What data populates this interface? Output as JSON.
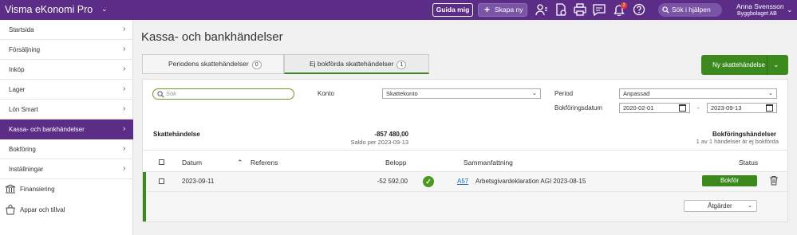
{
  "topbar": {
    "app_title": "Visma eKonomi Pro",
    "guide_label": "Guida mig",
    "create_label": "Skapa ny",
    "notification_count": "2",
    "help_search_label": "Sök i hjälpen",
    "user_name": "Anna Svensson",
    "company": "Byggbolaget AB",
    "icons": [
      "user-switch-icon",
      "document-icon",
      "print-icon",
      "chat-icon",
      "bell-icon",
      "help-icon",
      "search-icon"
    ]
  },
  "sidebar": {
    "items": [
      {
        "label": "Startsida"
      },
      {
        "label": "Försäljning"
      },
      {
        "label": "Inköp"
      },
      {
        "label": "Lager"
      },
      {
        "label": "Lön Smart"
      },
      {
        "label": "Kassa- och bankhändelser",
        "active": true
      },
      {
        "label": "Bokföring"
      },
      {
        "label": "Inställningar"
      }
    ],
    "extras": [
      {
        "label": "Finansiering",
        "icon": "finance-icon"
      },
      {
        "label": "Appar och tillval",
        "icon": "shopping-bag-icon"
      }
    ]
  },
  "page": {
    "title": "Kassa- och bankhändelser",
    "tabs": [
      {
        "label": "Periodens skattehändelser",
        "count": "0"
      },
      {
        "label": "Ej bokförda skattehändelser",
        "count": "1"
      }
    ],
    "new_button": "Ny skattehändelse"
  },
  "filters": {
    "search_placeholder": "Sök",
    "account_label": "Konto",
    "account_value": "Skattekonto",
    "period_label": "Period",
    "period_value": "Anpassad",
    "date_label": "Bokföringsdatum",
    "date_from": "2020-02-01",
    "date_sep": "-",
    "date_to": "2023-09-13"
  },
  "totals": {
    "label": "Skattehändelse",
    "amount": "-857 480,00",
    "saldo": "Saldo per 2023-09-13",
    "bf_title": "Bokföringshändelser",
    "bf_sub": "1 av 1 händelser är ej bokförda"
  },
  "table": {
    "headers": {
      "date": "Datum",
      "ref": "Referens",
      "amount": "Belopp",
      "summary": "Sammanfattning",
      "status": "Status"
    },
    "rows": [
      {
        "date": "2023-09-11",
        "ref": "",
        "amount": "-52 592,00",
        "link": "A57",
        "summary": "Arbetsgivardeklaration AGI 2023-08-15",
        "action": "Bokför"
      }
    ],
    "actions_label": "Åtgärder"
  }
}
